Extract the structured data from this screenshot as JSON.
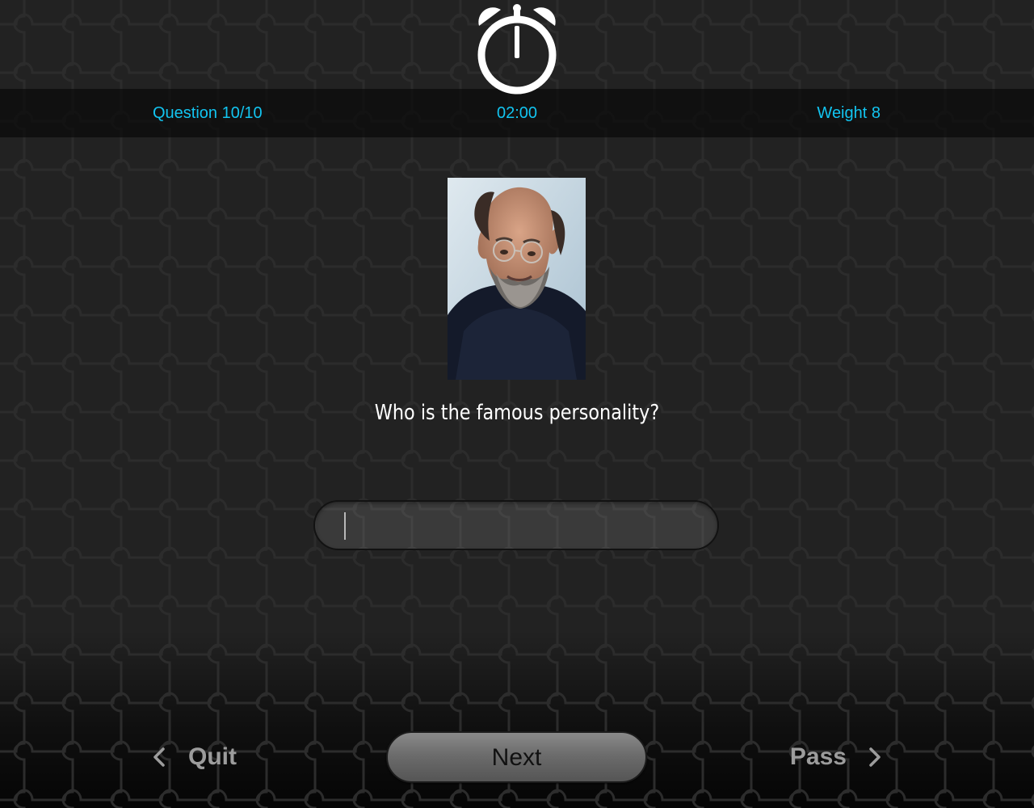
{
  "status": {
    "question": "Question 10/10",
    "timer": "02:00",
    "weight": "Weight 8"
  },
  "header": {
    "icon": "alarm-clock-icon"
  },
  "question": {
    "image_icon": "portrait-photo",
    "prompt": "Who is the famous personality?"
  },
  "answer": {
    "value": "",
    "placeholder": ""
  },
  "footer": {
    "quit_label": "Quit",
    "next_label": "Next",
    "pass_label": "Pass",
    "quit_icon": "chevron-left-icon",
    "pass_icon": "chevron-right-icon"
  },
  "colors": {
    "accent": "#12c4f0",
    "background": "#222222",
    "status_bar": "#0a0a0a",
    "nav_text": "#9c9c9c",
    "prompt_text": "#ffffff"
  }
}
